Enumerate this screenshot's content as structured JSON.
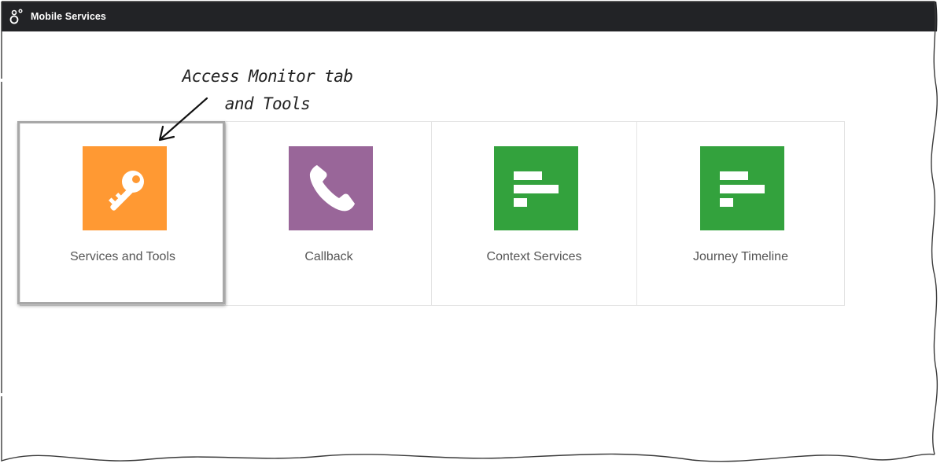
{
  "header": {
    "app_title": "Mobile Services",
    "logo_icon": "genesys-logo-icon",
    "background": "#222326"
  },
  "tiles": [
    {
      "label": "Services and Tools",
      "icon": "key-icon",
      "color": "#ff9933"
    },
    {
      "label": "Callback",
      "icon": "phone-icon",
      "color": "#996699"
    },
    {
      "label": "Context Services",
      "icon": "bars-icon",
      "color": "#33a23d"
    },
    {
      "label": "Journey Timeline",
      "icon": "bars-icon",
      "color": "#33a23d"
    }
  ],
  "annotation": {
    "line1": "Access Monitor tab",
    "line2": "and Tools",
    "arrow_icon": "arrow-icon"
  }
}
